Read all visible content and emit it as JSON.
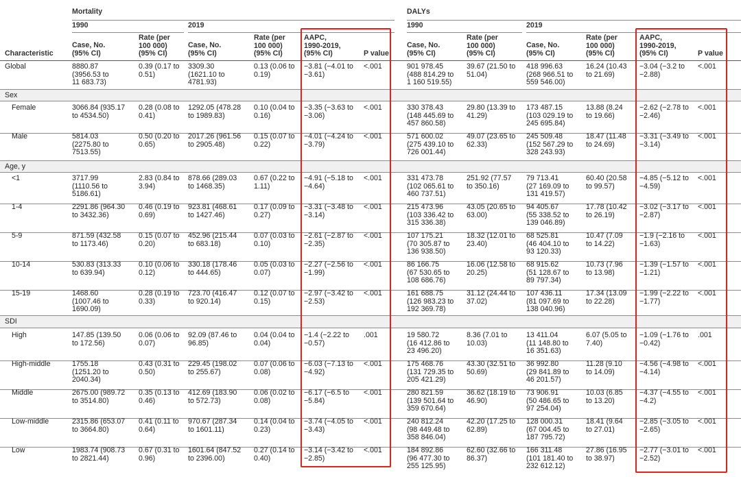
{
  "table": {
    "groups": [
      "Mortality",
      "DALYs"
    ],
    "years": [
      "1990",
      "2019"
    ],
    "col_headers": {
      "characteristic": "Characteristic",
      "case": "Case, No.\n(95% CI)",
      "rate": "Rate (per\n100 000)\n(95% CI)",
      "aapc": "AAPC,\n1990-2019,\n(95% CI)",
      "p": "P value"
    },
    "sections": [
      "Sex",
      "Age, y",
      "SDI"
    ],
    "rows": [
      {
        "label": "Global",
        "m90c": "8880.87\n(3956.53 to\n11 683.73)",
        "m90r": "0.39 (0.17 to\n0.51)",
        "m19c": "3309.30\n(1621.10 to\n4781.93)",
        "m19r": "0.13 (0.06 to\n0.19)",
        "ma": "−3.81 (−4.01 to\n−3.61)",
        "mp": "<.001",
        "d90c": "901 978.45\n(488 814.29 to\n1 160 519.55)",
        "d90r": "39.67 (21.50 to\n51.04)",
        "d19c": "418 996.63\n(268 966.51 to\n559 546.00)",
        "d19r": "16.24 (10.43\nto 21.69)",
        "da": "−3.04 (−3.2 to\n−2.88)",
        "dp": "<.001"
      },
      {
        "label": "Female",
        "m90c": "3066.84 (935.17\nto 4534.50)",
        "m90r": "0.28 (0.08 to\n0.41)",
        "m19c": "1292.05 (478.28\nto 1989.83)",
        "m19r": "0.10 (0.04 to\n0.16)",
        "ma": "−3.35 (−3.63 to\n−3.06)",
        "mp": "<.001",
        "d90c": "330 378.43\n(148 445.69 to\n457 860.58)",
        "d90r": "29.80 (13.39 to\n41.29)",
        "d19c": "173 487.15\n(103 029.19 to\n245 695.84)",
        "d19r": "13.88 (8.24\nto 19.66)",
        "da": "−2.62 (−2.78 to\n−2.46)",
        "dp": "<.001"
      },
      {
        "label": "Male",
        "m90c": "5814.03\n(2275.80 to\n7513.55)",
        "m90r": "0.50 (0.20 to\n0.65)",
        "m19c": "2017.26 (961.56\nto 2905.48)",
        "m19r": "0.15 (0.07 to\n0.22)",
        "ma": "−4.01 (−4.24 to\n−3.79)",
        "mp": "<.001",
        "d90c": "571 600.02\n(275 439.10 to\n726 001.44)",
        "d90r": "49.07 (23.65 to\n62.33)",
        "d19c": "245 509.48\n(152 567.29 to\n328 243.93)",
        "d19r": "18.47 (11.48\nto 24.69)",
        "da": "−3.31 (−3.49 to\n−3.14)",
        "dp": "<.001"
      },
      {
        "label": "<1",
        "m90c": "3717.99\n(1110.56 to\n5186.61)",
        "m90r": "2.83 (0.84 to\n3.94)",
        "m19c": "878.66 (289.03\nto 1468.35)",
        "m19r": "0.67 (0.22 to\n1.11)",
        "ma": "−4.91 (−5.18 to\n−4.64)",
        "mp": "<.001",
        "d90c": "331 473.78\n(102 065.61 to\n460 737.51)",
        "d90r": "251.92 (77.57\nto 350.16)",
        "d19c": "79 713.41\n(27 169.09 to\n131 419.57)",
        "d19r": "60.40 (20.58\nto 99.57)",
        "da": "−4.85 (−5.12 to\n−4.59)",
        "dp": "<.001"
      },
      {
        "label": "1-4",
        "m90c": "2291.86 (964.30\nto 3432.36)",
        "m90r": "0.46 (0.19 to\n0.69)",
        "m19c": "923.81 (468.61\nto 1427.46)",
        "m19r": "0.17 (0.09 to\n0.27)",
        "ma": "−3.31 (−3.48 to\n−3.14)",
        "mp": "<.001",
        "d90c": "215 473.96\n(103 336.42 to\n315 336.38)",
        "d90r": "43.05 (20.65 to\n63.00)",
        "d19c": "94 405.67\n(55 338.52 to\n139 046.89)",
        "d19r": "17.78 (10.42\nto 26.19)",
        "da": "−3.02 (−3.17 to\n−2.87)",
        "dp": "<.001"
      },
      {
        "label": "5-9",
        "m90c": "871.59 (432.58\nto 1173.46)",
        "m90r": "0.15 (0.07 to\n0.20)",
        "m19c": "452.96 (215.44\nto 683.18)",
        "m19r": "0.07 (0.03 to\n0.10)",
        "ma": "−2.61 (−2.87 to\n−2.35)",
        "mp": "<.001",
        "d90c": "107 175.21\n(70 305.87 to\n136 938.50)",
        "d90r": "18.32 (12.01 to\n23.40)",
        "d19c": "68 525.81\n(46 404.10 to\n93 120.33)",
        "d19r": "10.47 (7.09\nto 14.22)",
        "da": "−1.9 (−2.16 to\n−1.63)",
        "dp": "<.001"
      },
      {
        "label": "10-14",
        "m90c": "530.83 (313.33\nto 639.94)",
        "m90r": "0.10 (0.06 to\n0.12)",
        "m19c": "330.18 (178.46\nto 444.65)",
        "m19r": "0.05 (0.03 to\n0.07)",
        "ma": "−2.27 (−2.56 to\n−1.99)",
        "mp": "<.001",
        "d90c": "86 166.75\n(67 530.65 to\n108 686.76)",
        "d90r": "16.06 (12.58 to\n20.25)",
        "d19c": "68 915.62\n(51 128.67 to\n89 797.34)",
        "d19r": "10.73 (7.96\nto 13.98)",
        "da": "−1.39 (−1.57 to\n−1.21)",
        "dp": "<.001"
      },
      {
        "label": "15-19",
        "m90c": "1468.60\n(1007.46 to\n1690.09)",
        "m90r": "0.28 (0.19 to\n0.33)",
        "m19c": "723.70 (416.47\nto 920.14)",
        "m19r": "0.12 (0.07 to\n0.15)",
        "ma": "−2.97 (−3.42 to\n−2.53)",
        "mp": "<.001",
        "d90c": "161 688.75\n(126 983.23 to\n192 369.78)",
        "d90r": "31.12 (24.44 to\n37.02)",
        "d19c": "107 436.11\n(81 097.69 to\n138 040.96)",
        "d19r": "17.34 (13.09\nto 22.28)",
        "da": "−1.99 (−2.22 to\n−1.77)",
        "dp": "<.001"
      },
      {
        "label": "High",
        "m90c": "147.85 (139.50\nto 172.56)",
        "m90r": "0.06 (0.06 to\n0.07)",
        "m19c": "92.09 (87.46 to\n96.85)",
        "m19r": "0.04 (0.04 to\n0.04)",
        "ma": "−1.4 (−2.22 to\n−0.57)",
        "mp": ".001",
        "d90c": "19 580.72\n(16 412.86 to\n23 496.20)",
        "d90r": "8.36 (7.01 to\n10.03)",
        "d19c": "13 411.04\n(11 148.80 to\n16 351.63)",
        "d19r": "6.07 (5.05 to\n7.40)",
        "da": "−1.09 (−1.76 to\n−0.42)",
        "dp": ".001"
      },
      {
        "label": "High-middle",
        "m90c": "1755.18\n(1251.20 to\n2040.34)",
        "m90r": "0.43 (0.31 to\n0.50)",
        "m19c": "229.45 (198.02\nto 255.67)",
        "m19r": "0.07 (0.06 to\n0.08)",
        "ma": "−6.03 (−7.13 to\n−4.92)",
        "mp": "<.001",
        "d90c": "175 468.76\n(131 729.35 to\n205 421.29)",
        "d90r": "43.30 (32.51 to\n50.69)",
        "d19c": "36 992.80\n(29 841.89 to\n46 201.57)",
        "d19r": "11.28 (9.10\nto 14.09)",
        "da": "−4.56 (−4.98 to\n−4.14)",
        "dp": "<.001"
      },
      {
        "label": "Middle",
        "m90c": "2675.00 (989.72\nto 3514.80)",
        "m90r": "0.35 (0.13 to\n0.46)",
        "m19c": "412.69 (183.90\nto 572.73)",
        "m19r": "0.06 (0.02 to\n0.08)",
        "ma": "−6.17 (−6.5 to\n−5.84)",
        "mp": "<.001",
        "d90c": "280 821.59\n(139 501.64 to\n359 670.64)",
        "d90r": "36.62 (18.19 to\n46.90)",
        "d19c": "73 906.91\n(50 486.65 to\n97 254.04)",
        "d19r": "10.03 (6.85\nto 13.20)",
        "da": "−4.37 (−4.55 to\n−4.2)",
        "dp": "<.001"
      },
      {
        "label": "Low-middle",
        "m90c": "2315.86 (653.07\nto 3664.80)",
        "m90r": "0.41 (0.11 to\n0.64)",
        "m19c": "970.67 (287.34\nto 1601.11)",
        "m19r": "0.14 (0.04 to\n0.23)",
        "ma": "−3.74 (−4.05 to\n−3.43)",
        "mp": "<.001",
        "d90c": "240 812.24\n(98 449.48 to\n358 846.04)",
        "d90r": "42.20 (17.25 to\n62.89)",
        "d19c": "128 000.31\n(67 004.45 to\n187 795.72)",
        "d19r": "18.41 (9.64\nto 27.01)",
        "da": "−2.85 (−3.05 to\n−2.65)",
        "dp": "<.001"
      },
      {
        "label": "Low",
        "m90c": "1983.74 (908.73\nto 2821.44)",
        "m90r": "0.67 (0.31 to\n0.96)",
        "m19c": "1601.64 (847.52\nto 2396.00)",
        "m19r": "0.27 (0.14 to\n0.40)",
        "ma": "−3.14 (−3.42 to\n−2.85)",
        "mp": "<.001",
        "d90c": "184 892.86\n(96 477.30 to\n255 125.95)",
        "d90r": "62.60 (32.66 to\n86.37)",
        "d19c": "166 311.48\n(101 181.40 to\n232 612.12)",
        "d19r": "27.86 (16.95\nto 38.97)",
        "da": "−2.77 (−3.01 to\n−2.52)",
        "dp": "<.001"
      }
    ]
  }
}
